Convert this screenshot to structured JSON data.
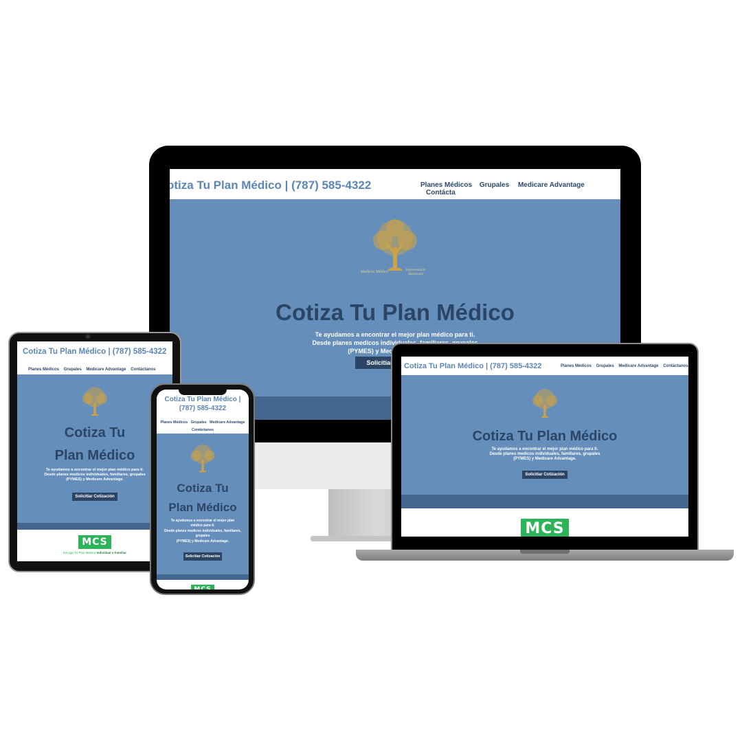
{
  "site": {
    "brand": "Cotiza Tu Plan Médico | (787) 585-4322",
    "brand_cut": "otiza Tu Plan Médico | (787) 585-4322",
    "brand_line1": "Cotiza Tu Plan Médico |",
    "brand_line2": "(787) 585-4322",
    "nav": {
      "planes": "Planes Médicos",
      "grupales": "Grupales",
      "medicare": "Medicare Advantage",
      "contacto": "Contáctanos",
      "contacto_cut": "Contácta"
    },
    "hero": {
      "title": "Cotiza Tu Plan Médico",
      "title_line1": "Cotiza Tu",
      "title_line2": "Plan Médico",
      "sub1": "Te ayudamos a encontrar el mejor plan médico para ti.",
      "sub2": "Desde planes medicos individuales, familiares, grupales",
      "sub3": "(PYMES) y Medicare Advantage.",
      "cta": "Solicitiar Cotización",
      "cta_cut": "Solicitiar C"
    },
    "logo_caption_left": "Medicos Médico",
    "logo_caption_right": "Representante Autorizado",
    "mcs": "MCS",
    "mcs_caption_a": "Escoge Tu Plan Médico",
    "mcs_caption_b": "Individual o Familiar"
  },
  "colors": {
    "brand_blue": "#5b86b3",
    "hero_bg": "#658eba",
    "hero_title": "#2a4565",
    "cta_bg": "#2d4564",
    "mcs_green": "#2db35a",
    "device_frame": "#000000"
  }
}
